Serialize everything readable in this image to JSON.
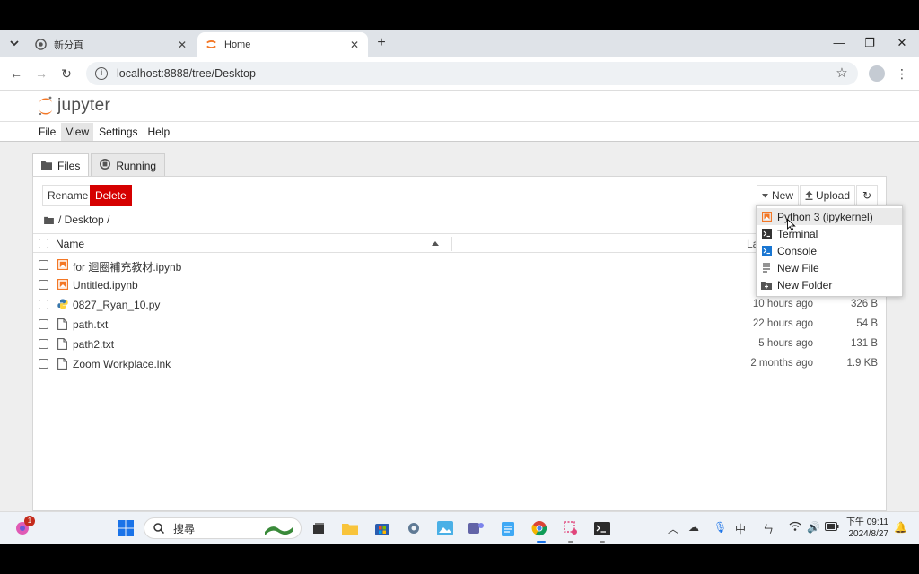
{
  "browser": {
    "tabs": [
      {
        "title": "新分頁",
        "active": false
      },
      {
        "title": "Home",
        "active": true
      }
    ],
    "url": "localhost:8888/tree/Desktop"
  },
  "jupyter": {
    "logo_text": "jupyter",
    "menu": [
      "File",
      "View",
      "Settings",
      "Help"
    ],
    "side_tabs": [
      "Files",
      "Running"
    ],
    "toolbar": {
      "rename": "Rename",
      "delete": "Delete",
      "new": "New",
      "upload": "Upload"
    },
    "breadcrumb": "/ Desktop /",
    "columns": {
      "name": "Name",
      "last_modified": "La"
    },
    "files": [
      {
        "name": "for 迴圈補充教材.ipynb",
        "type": "notebook",
        "modified": "",
        "size": ""
      },
      {
        "name": "Untitled.ipynb",
        "type": "notebook",
        "modified": "",
        "size": ""
      },
      {
        "name": "0827_Ryan_10.py",
        "type": "python",
        "modified": "10 hours ago",
        "size": "326 B"
      },
      {
        "name": "path.txt",
        "type": "file",
        "modified": "22 hours ago",
        "size": "54 B"
      },
      {
        "name": "path2.txt",
        "type": "file",
        "modified": "5 hours ago",
        "size": "131 B"
      },
      {
        "name": "Zoom Workplace.lnk",
        "type": "file",
        "modified": "2 months ago",
        "size": "1.9 KB"
      }
    ],
    "new_menu": [
      {
        "label": "Python 3 (ipykernel)",
        "icon": "notebook-icon"
      },
      {
        "label": "Terminal",
        "icon": "terminal-icon"
      },
      {
        "label": "Console",
        "icon": "console-icon"
      },
      {
        "label": "New File",
        "icon": "text-file-icon"
      },
      {
        "label": "New Folder",
        "icon": "new-folder-icon"
      }
    ]
  },
  "taskbar": {
    "search_placeholder": "搜尋",
    "notification_badge": "1",
    "ime_label": "中",
    "clock_line1": "下午 09:11",
    "clock_line2": "2024/8/27"
  },
  "colors": {
    "jupyter_orange": "#f37726",
    "delete_red": "#d50000",
    "python_blue": "#3776ab",
    "python_yellow": "#ffd43b"
  }
}
